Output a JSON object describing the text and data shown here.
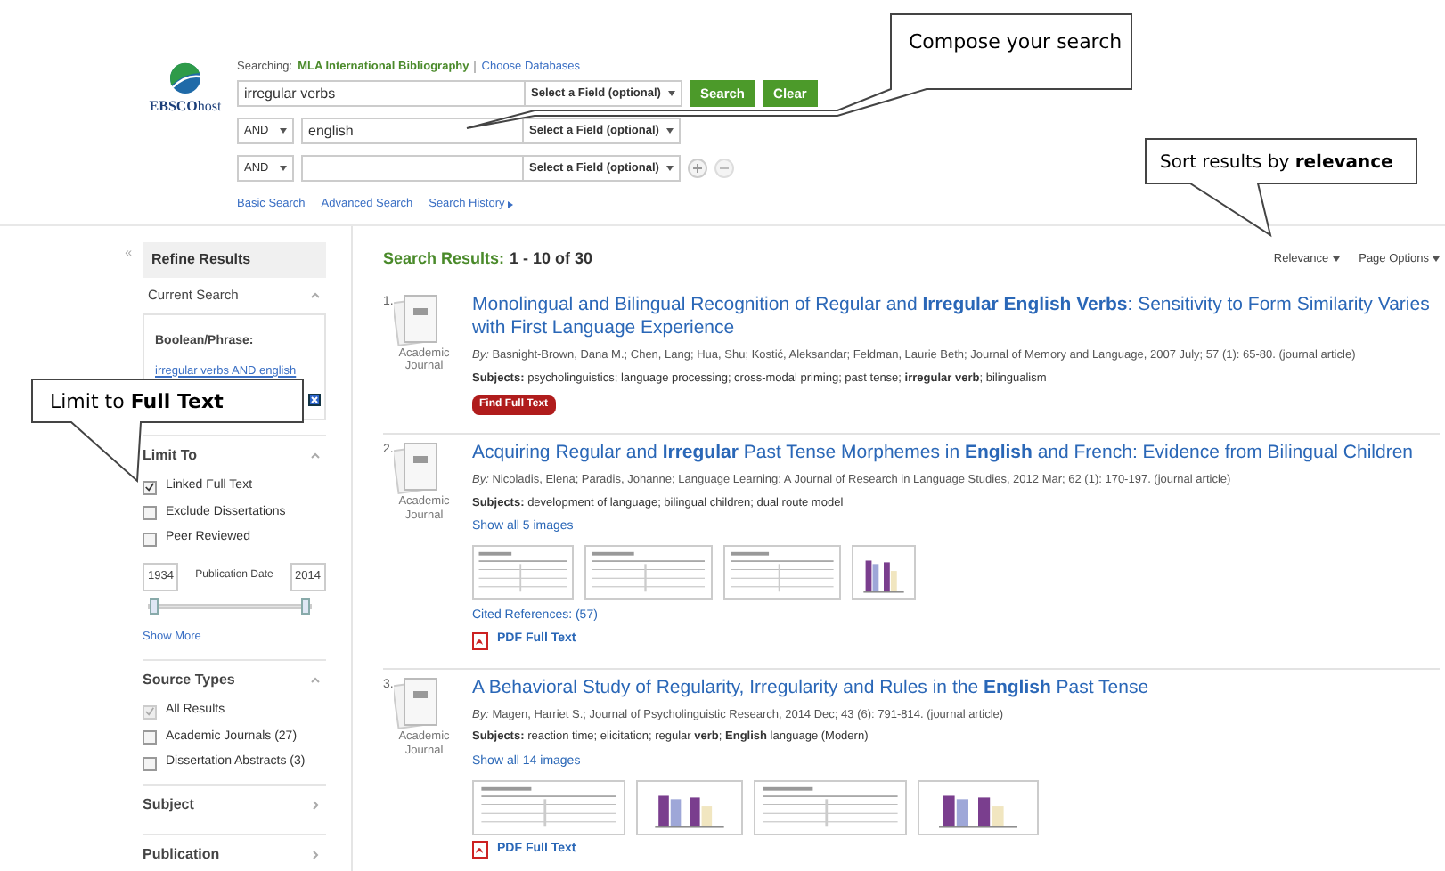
{
  "logo": {
    "text": "**EBSCO**host"
  },
  "searching": {
    "label": "Searching:",
    "database": "MLA International Bibliography",
    "choose_link": "Choose Databases"
  },
  "search_rows": [
    {
      "value": "irregular verbs",
      "field": "Select a Field (optional)"
    },
    {
      "operator": "AND",
      "value": "english",
      "field": "Select a Field (optional)"
    },
    {
      "operator": "AND",
      "field": "Select a Field (optional)"
    }
  ],
  "buttons": [
    "Search",
    "Clear"
  ],
  "search_links": [
    "Basic Search",
    "Advanced Search",
    "Search History"
  ],
  "sidebar": {
    "collapse": "«",
    "title": "Refine Results",
    "sections": [
      {
        "kind": "current_search",
        "title": "Current Search",
        "expanded": true,
        "label": "Boolean/Phrase:",
        "query": "irregular verbs AND english"
      },
      {
        "kind": "limits",
        "title": "Limit To",
        "expanded": true,
        "options": [
          {
            "label": "Linked Full Text",
            "checked": true,
            "disabled": false
          },
          {
            "label": "Exclude Dissertations",
            "checked": false,
            "disabled": false
          },
          {
            "label": "Peer Reviewed",
            "checked": false,
            "disabled": false
          }
        ],
        "date_from": "1934",
        "date_label": "Publication Date",
        "date_to": "2014",
        "handles": [
          {
            "level": 0
          },
          {
            "level": 1
          }
        ],
        "more": "Show More"
      },
      {
        "kind": "checklist",
        "title": "Source Types",
        "expanded": true,
        "options": [
          {
            "label": "All Results",
            "checked": true,
            "disabled": true
          },
          {
            "label": "Academic Journals (27)",
            "checked": false,
            "disabled": false
          },
          {
            "label": "Dissertation Abstracts (3)",
            "checked": false,
            "disabled": false
          }
        ]
      },
      {
        "kind": "header",
        "title": "Subject",
        "expanded": false
      },
      {
        "kind": "header",
        "title": "Publication",
        "expanded": false
      }
    ]
  },
  "results": {
    "label": "Search Results:",
    "range": "1 - 10 of 30",
    "sort": "Relevance",
    "options": "Page Options",
    "items": [
      {
        "number": "1.",
        "type": "Academic Journal",
        "title": "Monolingual and Bilingual Recognition of Regular and **Irregular English Verbs**: Sensitivity to Form Similarity Varies with First Language Experience",
        "by": "*By:* Basnight-Brown, Dana M.; Chen, Lang; Hua, Shu; Kostić, Aleksandar; Feldman, Laurie Beth; Journal of Memory and Language, 2007 July; 57 (1): 65-80. (journal article)",
        "subjects": "**Subjects:** psycholinguistics; language processing; cross-modal priming; past tense; **irregular verb**; bilingualism",
        "find_button": "Find Full Text"
      },
      {
        "number": "2.",
        "type": "Academic Journal",
        "title": "Acquiring Regular and **Irregular** Past Tense Morphemes in **English** and French: Evidence from Bilingual Children",
        "by": "*By:* Nicoladis, Elena; Paradis, Johanne; Language Learning: A Journal of Research in Language Studies, 2012 Mar; 62 (1): 170-197. (journal article)",
        "subjects": "**Subjects:** development of language; bilingual children; dual route model",
        "images_link": "Show all 5 images",
        "images": [
          {
            "kind": "table"
          },
          {
            "kind": "table"
          },
          {
            "kind": "table"
          },
          {
            "kind": "chart"
          }
        ],
        "cited": "Cited References: (57)",
        "pdf": "PDF Full Text"
      },
      {
        "number": "3.",
        "type": "Academic Journal",
        "title": "A Behavioral Study of Regularity, Irregularity and Rules in the **English** Past Tense",
        "by": "*By:* Magen, Harriet S.; Journal of Psycholinguistic Research, 2014 Dec; 43 (6): 791-814. (journal article)",
        "subjects": "**Subjects:** reaction time; elicitation; regular **verb**; **English** language (Modern)",
        "images_link": "Show all 14 images",
        "images": [
          {
            "kind": "table"
          },
          {
            "kind": "chart"
          },
          {
            "kind": "table"
          },
          {
            "kind": "chart"
          }
        ],
        "pdf": "PDF Full Text"
      }
    ]
  },
  "callouts": [
    {
      "text": "Compose your search"
    },
    {
      "text": "Sort results by **relevance**"
    },
    {
      "text": "Limit to **Full Text**"
    }
  ]
}
